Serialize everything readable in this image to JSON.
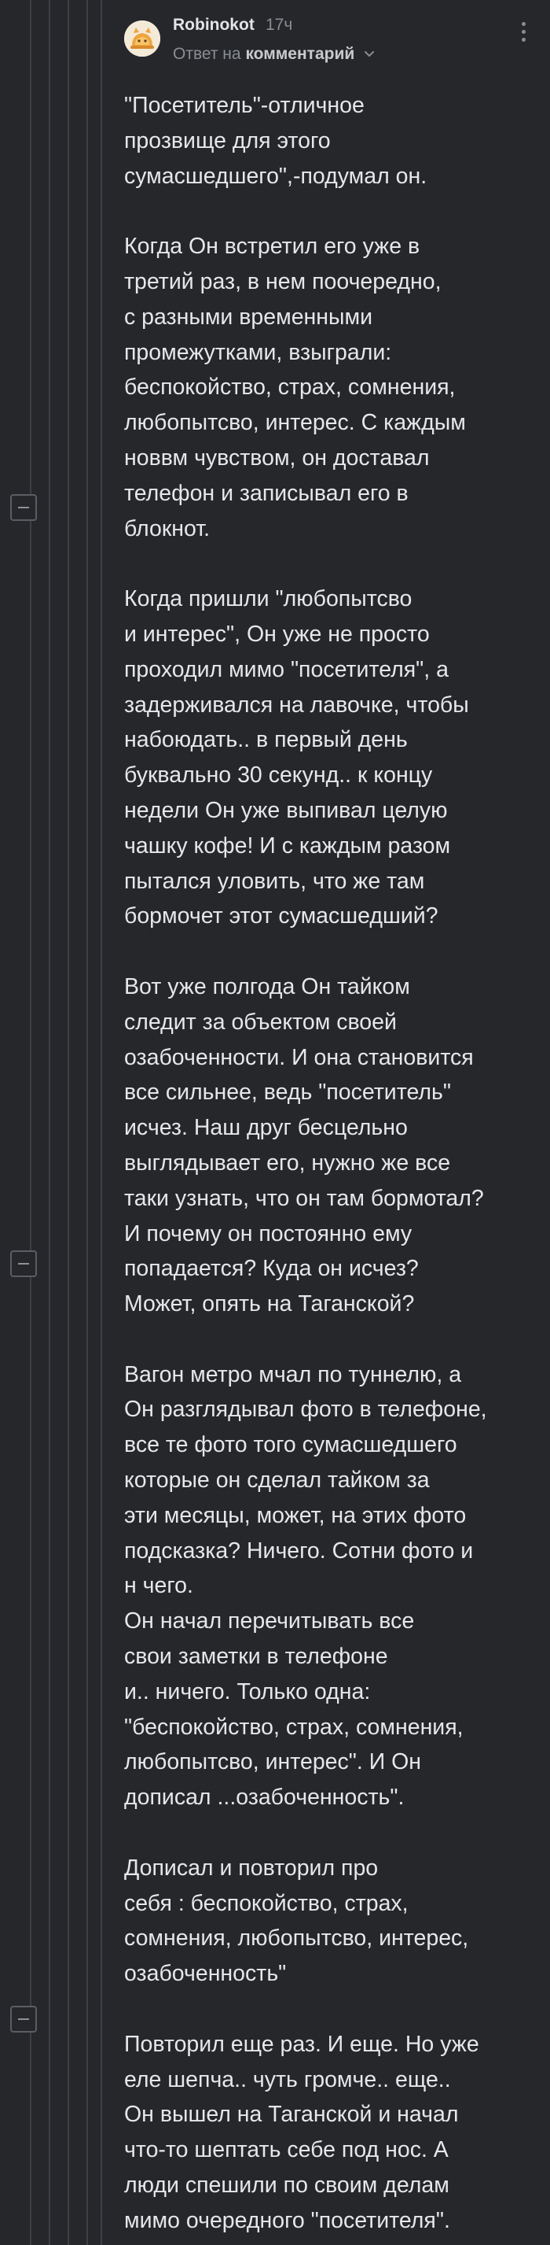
{
  "comment": {
    "author": "Robinokot",
    "time": "17ч",
    "reply_prefix": "Ответ на",
    "reply_link": "комментарий",
    "paragraphs": [
      "\"Посетитель\"-отличное\nпрозвище для этого\nсумасшедшего\",-подумал он.",
      "Когда Он встретил его уже в\nтретий раз, в нем поочередно,\nс разными временными\nпромежутками, взыграли:\nбеспокойство, страх, сомнения,\nлюбопытсво, интерес. С каждым\nноввм чувством, он доставал\nтелефон и записывал его в\nблокнот.",
      "Когда пришли \"любопытсво\nи интерес\", Он уже не просто\nпроходил мимо \"посетителя\", а\nзадерживался на лавочке, чтобы\nнабоюдать.. в первый день\nбуквально 30 секунд.. к концу\nнедели Он уже выпивал целую\nчашку кофе! И с каждым разом\nпытался уловить, что же там\nбормочет этот сумасшедший?",
      "Вот уже полгода Он тайком\nследит за объектом своей\nозабоченности. И она становится\nвсе сильнее, ведь \"посетитель\"\nисчез. Наш друг бесцельно\nвыглядывает его, нужно же все\nтаки узнать, что он там бормотал?\nИ почему он постоянно ему\nпопадается? Куда он исчез?\nМожет, опять на Таганской?",
      "Вагон метро мчал по туннелю, а\nОн разглядывал фото в телефоне,\nвсе те фото того сумасшедшего\nкоторые он сделал тайком за\nэти месяцы, может, на этих фото\nподсказка? Ничего. Сотни фото и\nн чего.\nОн начал перечитывать все\nсвои заметки в телефоне\nи.. ничего. Только одна:\n\"беспокойство, страх, сомнения,\nлюбопытсво, интерес\". И Он\nдописал ...озабоченность\".",
      "Дописал и повторил про\nсебя : беспокойство, страх,\nсомнения, любопытсво, интерес,\nозабоченность\"",
      "Повторил еще раз. И еще. Но уже\nеле шепча.. чуть громче.. еще..\nОн вышел на Таганской и начал\nчто-то шептать себе под нос. А\nлюди  спешили по своим делам\nмимо очередного \"посетителя\"."
    ]
  }
}
